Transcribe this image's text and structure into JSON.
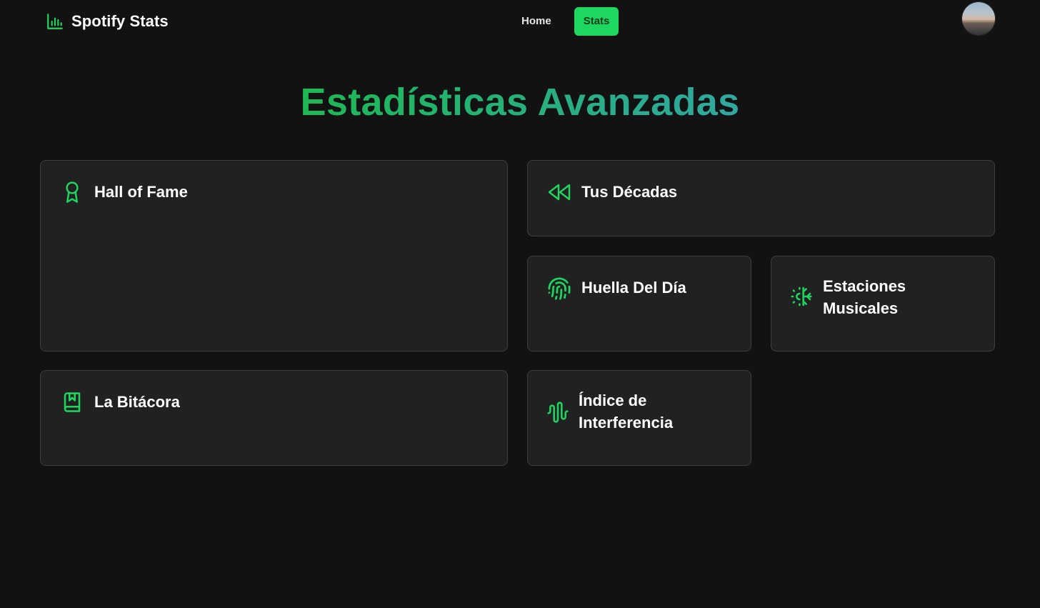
{
  "brand": {
    "name": "Spotify Stats",
    "icon": "bar-chart-icon"
  },
  "nav": {
    "links": [
      {
        "label": "Home",
        "active": false
      },
      {
        "label": "Stats",
        "active": true
      }
    ]
  },
  "user": {
    "avatar": "user-avatar"
  },
  "page": {
    "title": "Estadísticas Avanzadas"
  },
  "cards": {
    "hall_of_fame": {
      "title": "Hall of Fame",
      "icon": "award-ribbon-icon"
    },
    "decadas": {
      "title": "Tus Décadas",
      "icon": "rewind-icon"
    },
    "huella": {
      "title": "Huella Del Día",
      "icon": "fingerprint-icon"
    },
    "estaciones": {
      "title": "Estaciones Musicales",
      "icon": "sun-snow-icon"
    },
    "bitacora": {
      "title": "La Bitácora",
      "icon": "bookmark-book-icon"
    },
    "interferencia": {
      "title": "Índice de Interferencia",
      "icon": "waveform-icon"
    }
  },
  "colors": {
    "accent": "#1ed760",
    "background": "#121212",
    "card": "#212121",
    "title_gradient_start": "#1db954",
    "title_gradient_end": "#30a8a1"
  }
}
